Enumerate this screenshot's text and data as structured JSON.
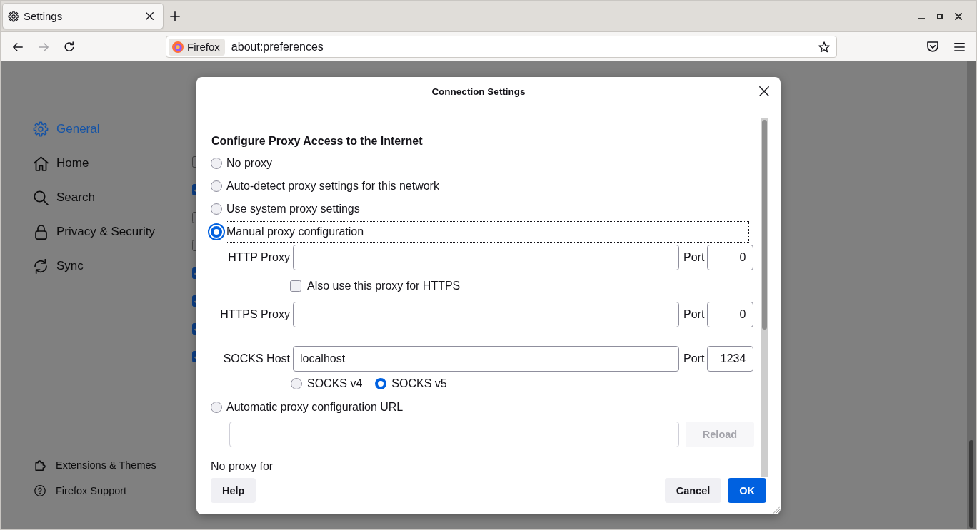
{
  "browser": {
    "tabs": [
      {
        "label": "Settings",
        "selected": true
      }
    ],
    "nav_buttons": [
      {
        "kind": "back",
        "disabled": false
      },
      {
        "kind": "forward",
        "disabled": true
      },
      {
        "kind": "reload",
        "disabled": false
      }
    ],
    "url_bar": {
      "identity": "Firefox",
      "url": "about:preferences"
    }
  },
  "sidebar": {
    "items": [
      {
        "label": "General",
        "kind": "general",
        "selected": true
      },
      {
        "label": "Home",
        "kind": "home",
        "selected": false
      },
      {
        "label": "Search",
        "kind": "search",
        "selected": false
      },
      {
        "label": "Privacy & Security",
        "kind": "privacy",
        "selected": false
      },
      {
        "label": "Sync",
        "kind": "sync",
        "selected": false
      }
    ],
    "footer_links": [
      {
        "label": "Extensions & Themes",
        "kind": "extensions"
      },
      {
        "label": "Firefox Support",
        "kind": "support"
      }
    ]
  },
  "background_checkboxes": [
    {
      "checked": false
    },
    {
      "checked": true
    },
    {
      "checked": false
    },
    {
      "checked": false
    },
    {
      "checked": true
    },
    {
      "checked": true
    },
    {
      "checked": true
    },
    {
      "checked": true
    }
  ],
  "dialog": {
    "title": "Connection Settings",
    "heading": "Configure Proxy Access to the Internet",
    "proxy_modes": [
      {
        "label": "No proxy",
        "selected": false,
        "focused": false
      },
      {
        "label": "Auto-detect proxy settings for this network",
        "selected": false,
        "focused": false
      },
      {
        "label": "Use system proxy settings",
        "selected": false,
        "focused": false
      },
      {
        "label": "Manual proxy configuration",
        "selected": true,
        "focused": true,
        "rows": [
          {
            "kind": "field",
            "label": "HTTP Proxy",
            "port_label": "Port",
            "port": "0"
          },
          {
            "kind": "checkbox",
            "label": "Also use this proxy for HTTPS",
            "checked": false
          },
          {
            "kind": "field",
            "label": "HTTPS Proxy",
            "port_label": "Port",
            "port": "0"
          },
          {
            "kind": "field",
            "label": "SOCKS Host",
            "value": "localhost",
            "port_label": "Port",
            "port": "1234"
          },
          {
            "kind": "radios",
            "options": [
              {
                "label": "SOCKS v4",
                "selected": false
              },
              {
                "label": "SOCKS v5",
                "selected": true
              }
            ]
          }
        ]
      },
      {
        "label": "Automatic proxy configuration URL",
        "selected": false,
        "focused": false,
        "url_field": {
          "disabled": true
        },
        "reload_button": {
          "label": "Reload",
          "disabled": true
        }
      }
    ],
    "no_proxy_for": {
      "label": "No proxy for"
    },
    "buttons": [
      {
        "label": "Help",
        "kind": "help"
      },
      {
        "label": "Cancel",
        "kind": "secondary"
      },
      {
        "label": "OK",
        "kind": "primary"
      }
    ]
  }
}
